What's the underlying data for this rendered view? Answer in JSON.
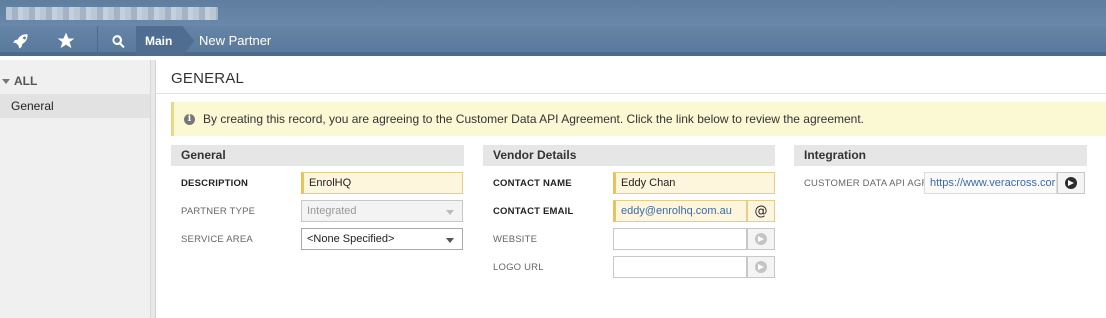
{
  "nav": {
    "main_label": "Main",
    "current_label": "New Partner",
    "icons": [
      "rocket-icon",
      "star-icon",
      "search-icon"
    ]
  },
  "sidebar": {
    "heading": "ALL",
    "items": [
      {
        "label": "General",
        "selected": true
      }
    ]
  },
  "page": {
    "title": "GENERAL",
    "notice": "By creating this record, you are agreeing to the Customer Data API Agreement. Click the link below to review the agreement."
  },
  "general": {
    "heading": "General",
    "description_label": "DESCRIPTION",
    "description_value": "EnrolHQ",
    "partner_type_label": "PARTNER TYPE",
    "partner_type_value": "Integrated",
    "service_area_label": "SERVICE AREA",
    "service_area_value": "<None Specified>"
  },
  "vendor": {
    "heading": "Vendor Details",
    "contact_name_label": "CONTACT NAME",
    "contact_name_value": "Eddy Chan",
    "contact_email_label": "CONTACT EMAIL",
    "contact_email_value": "eddy@enrolhq.com.au",
    "email_button": "@",
    "website_label": "WEBSITE",
    "website_value": "",
    "logo_url_label": "LOGO URL",
    "logo_url_value": ""
  },
  "integration": {
    "heading": "Integration",
    "agreement_label": "CUSTOMER DATA API AGR...",
    "agreement_value": "https://www.veracross.cor"
  },
  "colors": {
    "navbar": "#5a7a9d",
    "required_field": "#fdf5dc",
    "notice_bg": "#fbf8d4"
  }
}
